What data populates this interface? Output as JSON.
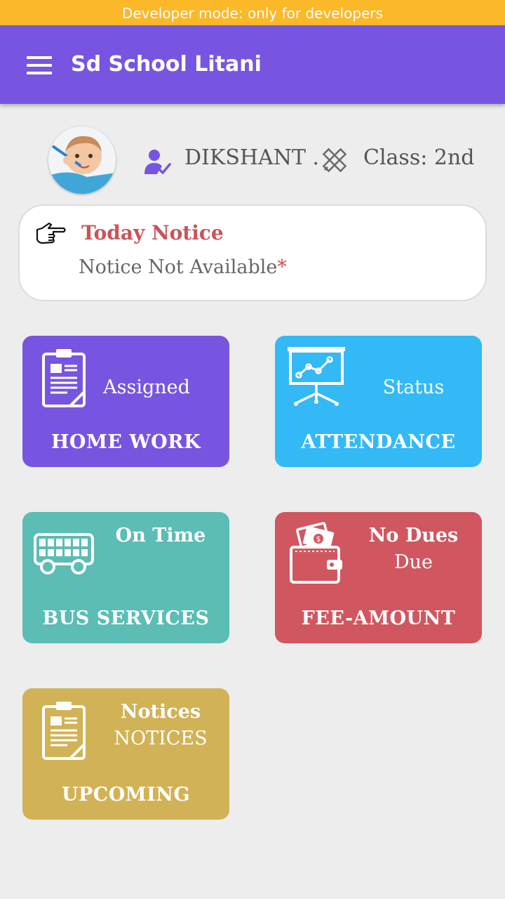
{
  "dev_banner": "Developer mode: only for developers",
  "app": {
    "title": "Sd School Litani"
  },
  "student": {
    "name": "DIKSHANT .",
    "class_label": "Class: 2nd"
  },
  "notice": {
    "title": "Today Notice",
    "text": "Notice Not Available",
    "marker": "*"
  },
  "tiles": [
    {
      "status": "Assigned",
      "caption": "HOME WORK",
      "color": "#7755e0",
      "icon": "clipboard-icon"
    },
    {
      "status": "Status",
      "caption": "ATTENDANCE",
      "color": "#33b9f5",
      "icon": "presentation-chart-icon"
    },
    {
      "status": "On Time",
      "caption": "BUS SERVICES",
      "color": "#5bbdb5",
      "icon": "bus-icon"
    },
    {
      "status": "No Dues",
      "status2": "Due",
      "caption": "FEE-AMOUNT",
      "color": "#d0575f",
      "icon": "wallet-icon"
    },
    {
      "status": "Notices",
      "status2": "NOTICES",
      "caption": "UPCOMING",
      "color": "#d1b256",
      "icon": "clipboard-icon"
    }
  ],
  "colors": {
    "primary": "#7755e0",
    "dev_banner": "#fbb829",
    "notice_title": "#c9535a"
  }
}
